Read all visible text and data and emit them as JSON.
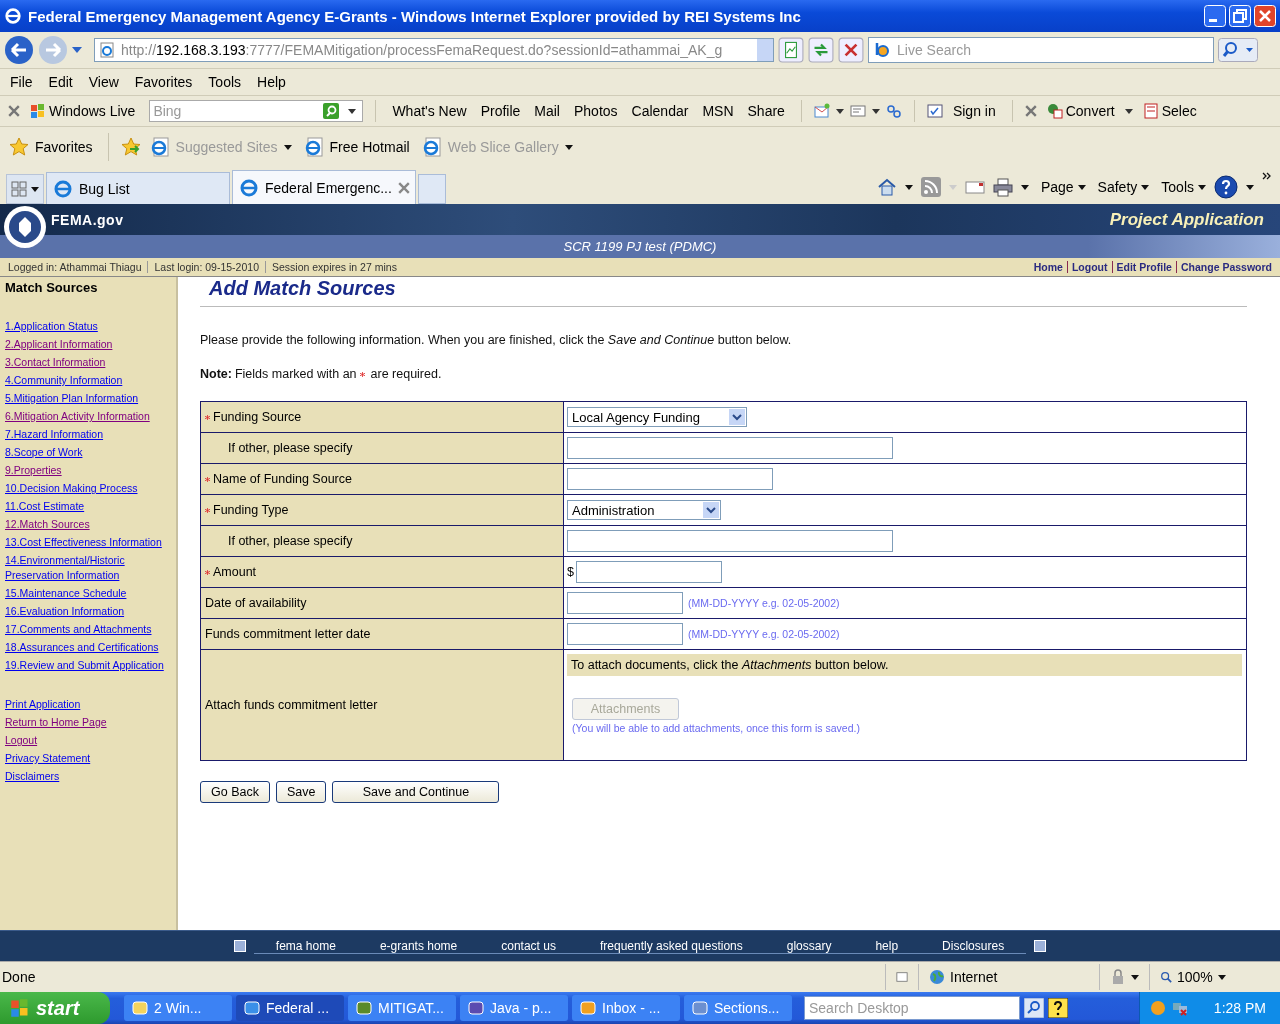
{
  "window": {
    "title": "Federal Emergency Management Agency E-Grants - Windows Internet Explorer provided by REI Systems Inc"
  },
  "address_bar": {
    "scheme": "http://",
    "host": "192.168.3.193",
    "path": ":7777/FEMAMitigation/processFemaRequest.do?sessionId=athammai_AK_g"
  },
  "search": {
    "placeholder": "Live Search"
  },
  "menu": [
    "File",
    "Edit",
    "View",
    "Favorites",
    "Tools",
    "Help"
  ],
  "links_toolbar": {
    "brand": "Windows Live",
    "search_placeholder": "Bing",
    "links": [
      "What's New",
      "Profile",
      "Mail",
      "Photos",
      "Calendar",
      "MSN",
      "Share"
    ],
    "sign_in": "Sign in",
    "convert": "Convert",
    "select": "Selec"
  },
  "favorites_bar": {
    "label": "Favorites",
    "items": [
      {
        "label": "Suggested Sites",
        "dimmed": true,
        "dropdown": true
      },
      {
        "label": "Free Hotmail",
        "dimmed": false,
        "dropdown": false
      },
      {
        "label": "Web Slice Gallery",
        "dimmed": true,
        "dropdown": true
      }
    ]
  },
  "tabs": [
    {
      "label": "Bug List",
      "selected": false
    },
    {
      "label": "Federal Emergenc...",
      "selected": true
    }
  ],
  "command_bar": [
    "Page",
    "Safety",
    "Tools"
  ],
  "site_header": {
    "logo": "FEMA.gov",
    "app_title": "Project Application",
    "project": "SCR 1199 PJ test (PDMC)"
  },
  "session_bar": {
    "items": [
      "Logged in: Athammai Thiagu",
      "Last login: 09-15-2010",
      "Session expires in 27 mins"
    ],
    "links": [
      "Home",
      "Logout",
      "Edit Profile",
      "Change Password"
    ]
  },
  "sidebar": {
    "title": "Match Sources",
    "steps": [
      {
        "label": "1.Application Status",
        "visited": false
      },
      {
        "label": "2.Applicant Information",
        "visited": true
      },
      {
        "label": "3.Contact Information",
        "visited": true
      },
      {
        "label": "4.Community Information",
        "visited": false
      },
      {
        "label": "5.Mitigation Plan Information",
        "visited": false
      },
      {
        "label": "6.Mitigation Activity Information",
        "visited": true
      },
      {
        "label": "7.Hazard Information",
        "visited": false
      },
      {
        "label": "8.Scope of Work",
        "visited": false
      },
      {
        "label": "9.Properties",
        "visited": true
      },
      {
        "label": "10.Decision Making Process",
        "visited": false
      },
      {
        "label": "11.Cost Estimate",
        "visited": false
      },
      {
        "label": "12.Match Sources",
        "visited": true
      },
      {
        "label": "13.Cost Effectiveness Information",
        "visited": false
      },
      {
        "label": "14.Environmental/Historic Preservation Information",
        "visited": false
      },
      {
        "label": "15.Maintenance Schedule",
        "visited": false
      },
      {
        "label": "16.Evaluation Information",
        "visited": false
      },
      {
        "label": "17.Comments and Attachments",
        "visited": false
      },
      {
        "label": "18.Assurances and Certifications",
        "visited": false
      },
      {
        "label": "19.Review and Submit Application",
        "visited": false
      }
    ],
    "links": [
      {
        "label": "Print Application",
        "visited": false
      },
      {
        "label": "Return to Home Page",
        "visited": true
      },
      {
        "label": "Logout",
        "visited": true
      },
      {
        "label": "Privacy Statement",
        "visited": false
      },
      {
        "label": "Disclaimers",
        "visited": false
      }
    ]
  },
  "page": {
    "heading": "Add Match Sources",
    "intro": "Please provide the following information. When you are finished, click the *Save and Continue* button below.",
    "note_label": "Note:",
    "note_before": "Fields marked with an",
    "note_after": "are required."
  },
  "form_rows": [
    {
      "kind": "select",
      "label": "Funding Source",
      "required": true,
      "indented": false,
      "value": "Local Agency Funding"
    },
    {
      "kind": "text",
      "label": "If other, please specify",
      "required": false,
      "indented": true
    },
    {
      "kind": "short_text",
      "label": "Name of Funding Source",
      "required": true,
      "indented": false
    },
    {
      "kind": "select",
      "label": "Funding Type",
      "required": true,
      "indented": false,
      "value": "Administration"
    },
    {
      "kind": "text",
      "label": "If other, please specify",
      "required": false,
      "indented": true
    },
    {
      "kind": "amount",
      "label": "Amount",
      "required": true,
      "indented": false,
      "currency": "$"
    },
    {
      "kind": "date",
      "label": "Date of availability",
      "required": false,
      "indented": false,
      "hint": "(MM-DD-YYYY e.g. 02-05-2002)"
    },
    {
      "kind": "date",
      "label": "Funds commitment letter date",
      "required": false,
      "indented": false,
      "hint": "(MM-DD-YYYY e.g. 02-05-2002)"
    },
    {
      "kind": "attachment",
      "label": "Attach funds commitment letter",
      "required": false,
      "indented": false,
      "instruction": "To attach documents, click the *Attachments* button below.",
      "button": "Attachments",
      "disabled": true,
      "hint": "(You will be able to add attachments, once this form is saved.)"
    }
  ],
  "buttons": [
    "Go Back",
    "Save",
    "Save and Continue"
  ],
  "footer_links": [
    "fema home",
    "e-grants home",
    "contact us",
    "frequently asked questions",
    "glossary",
    "help",
    "Disclosures"
  ],
  "status_bar": {
    "text": "Done",
    "zone": "Internet",
    "zoom": "100%"
  },
  "taskbar": {
    "start": "start",
    "items": [
      {
        "label": "2 Win...",
        "selected": false,
        "kind": "folder"
      },
      {
        "label": "Federal ...",
        "selected": true,
        "kind": "browser"
      },
      {
        "label": "MITIGAT...",
        "selected": false,
        "kind": "app"
      },
      {
        "label": "Java - p...",
        "selected": false,
        "kind": "ide"
      },
      {
        "label": "Inbox - ...",
        "selected": false,
        "kind": "mail"
      },
      {
        "label": "Sections...",
        "selected": false,
        "kind": "document"
      }
    ],
    "search_placeholder": "Search Desktop",
    "clock": "1:28 PM"
  }
}
